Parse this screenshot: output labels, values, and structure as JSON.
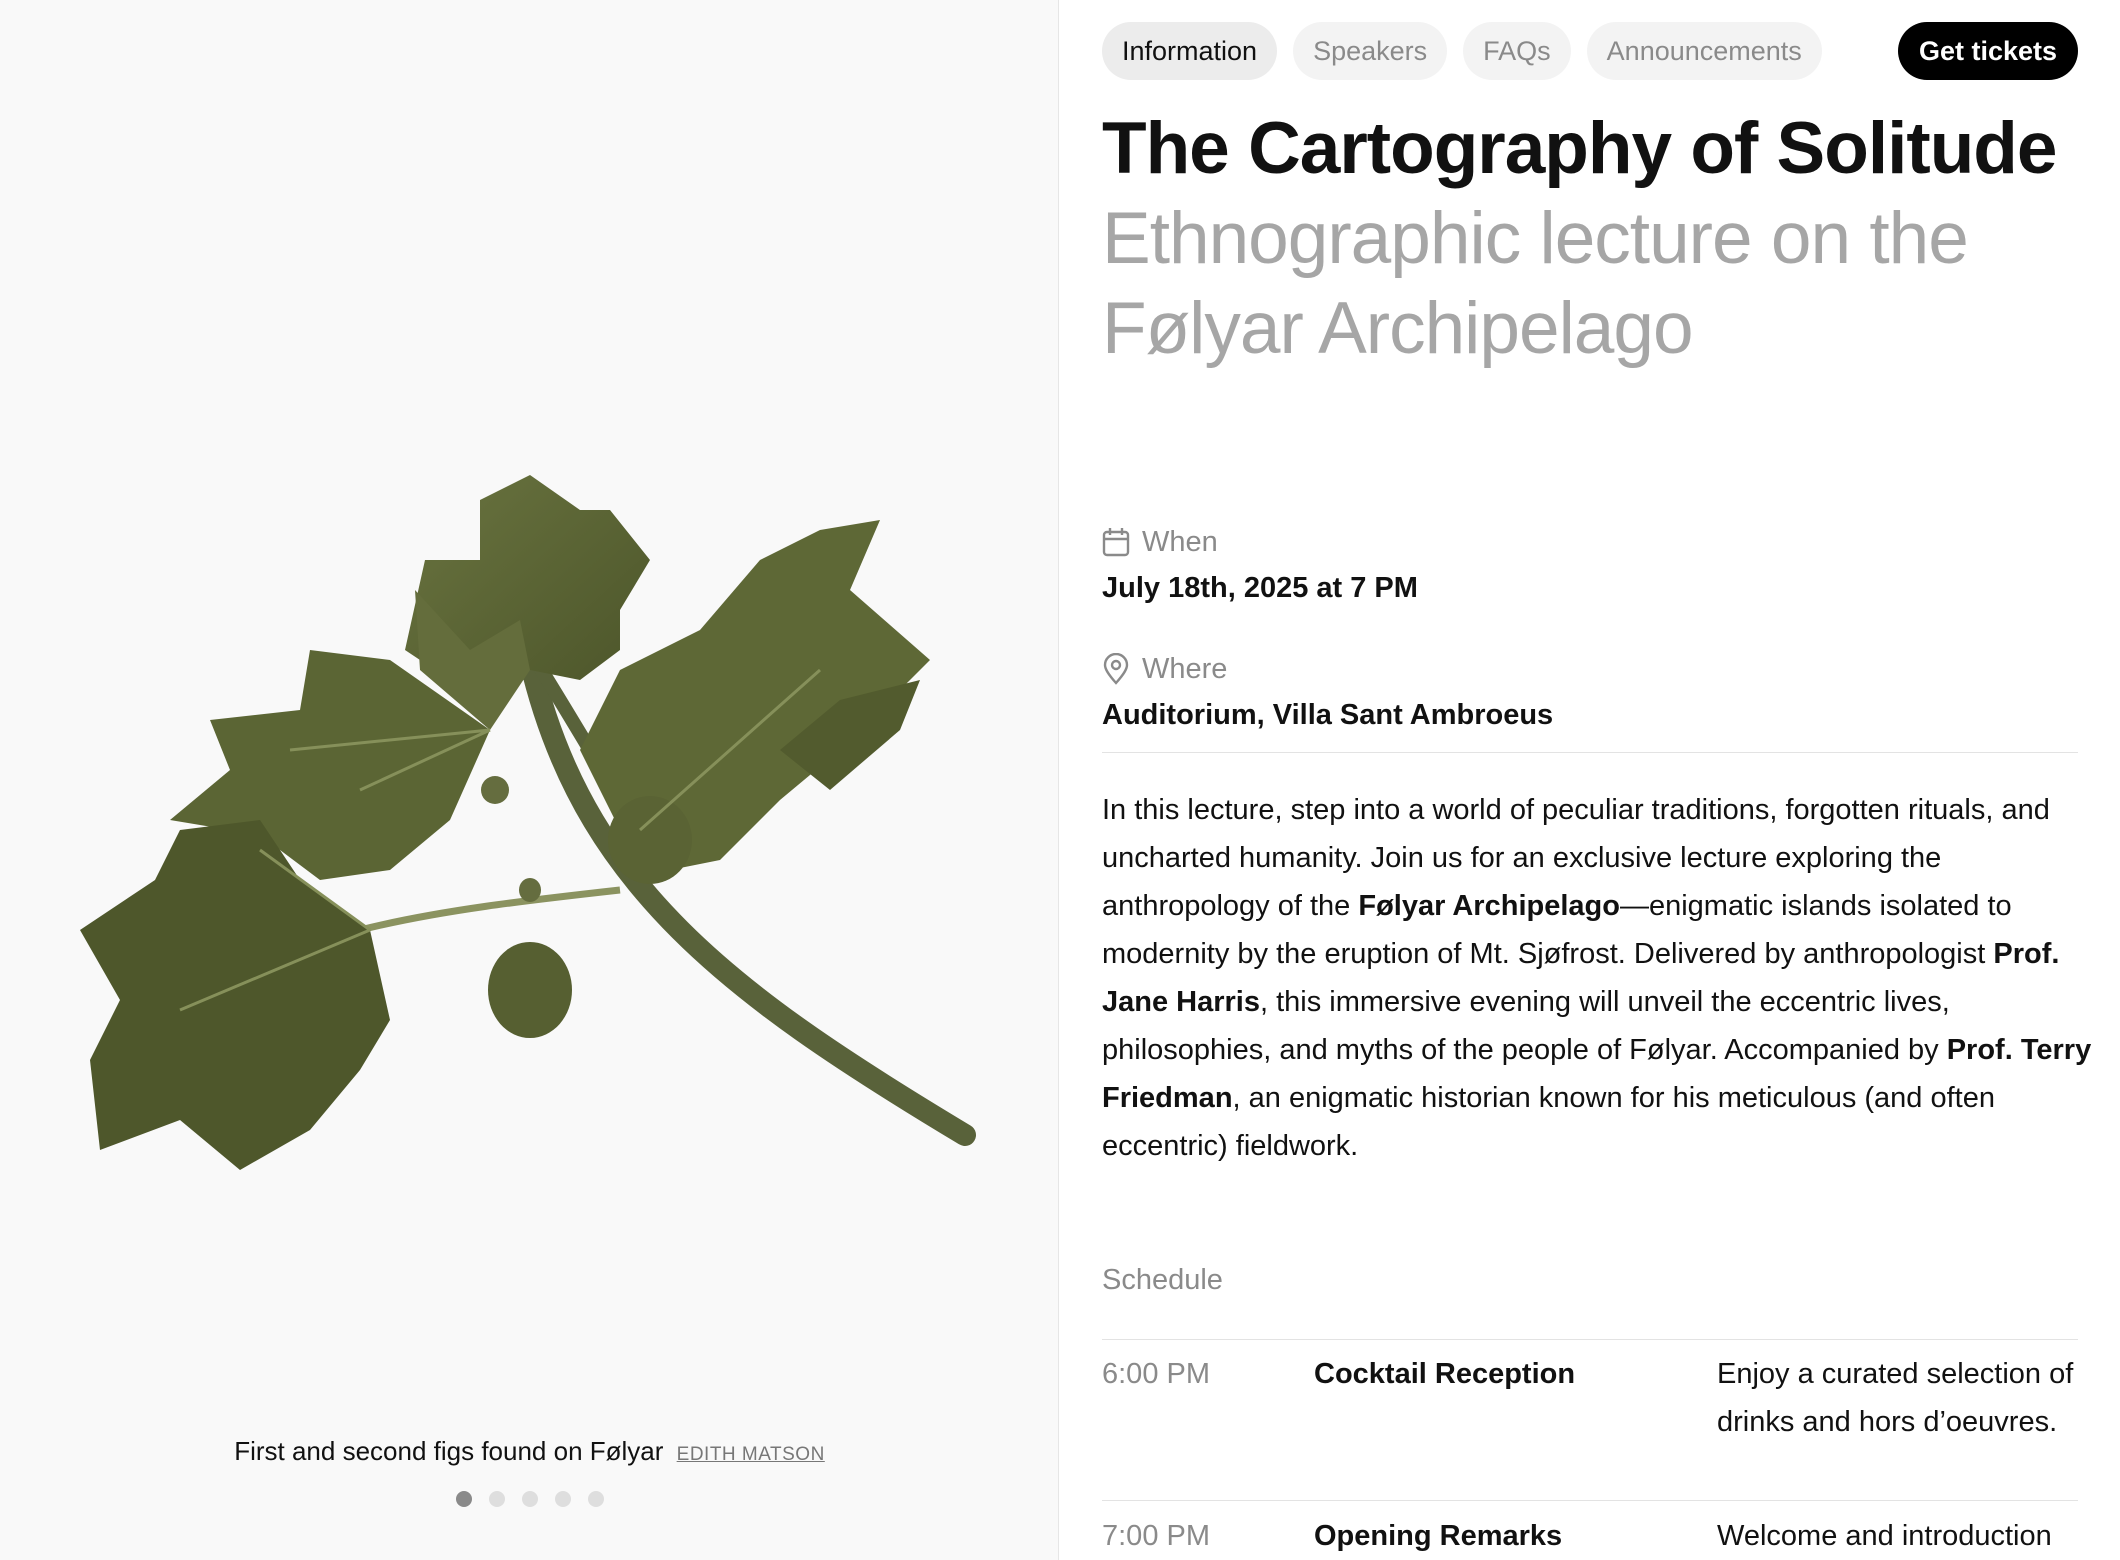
{
  "gallery": {
    "caption": "First and second figs found on Følyar",
    "credit": "EDITH MATSON",
    "image_icon": "fig-branch-illustration",
    "dot_count": 5,
    "active_dot": 1
  },
  "nav": {
    "tabs": [
      {
        "label": "Information",
        "active": true
      },
      {
        "label": "Speakers",
        "active": false
      },
      {
        "label": "FAQs",
        "active": false
      },
      {
        "label": "Announcements",
        "active": false
      }
    ],
    "cta_label": "Get tickets"
  },
  "event": {
    "title": "The Cartography of Solitude",
    "subtitle": "Ethnographic lecture on the Følyar Archipelago",
    "when_label": "When",
    "when_value": "July 18th, 2025 at 7 PM",
    "where_label": "Where",
    "where_value": "Auditorium, Villa Sant Ambroeus"
  },
  "description": {
    "p1": "In this lecture, step into a world of peculiar traditions, forgotten rituals, and uncharted humanity. Join us for an exclusive lecture exploring the anthropology of the ",
    "b1": "Følyar Archipelago",
    "p2": "—enigmatic islands isolated to modernity by the eruption of Mt. Sjøfrost. Delivered by anthropologist ",
    "b2": "Prof. Jane Harris",
    "p3": ", this immersive evening will unveil the eccentric lives, philosophies, and myths of the people of Følyar. Accompanied by ",
    "b3": "Prof. Terry Friedman",
    "p4": ", an enigmatic historian known for his meticulous (and often eccentric) fieldwork."
  },
  "schedule": {
    "title": "Schedule",
    "items": [
      {
        "time": "6:00 PM",
        "name": "Cocktail Reception",
        "desc": "Enjoy a curated selection of drinks and hors d’oeuvres."
      },
      {
        "time": "7:00 PM",
        "name": "Opening Remarks",
        "desc": "Welcome and introduction"
      }
    ]
  },
  "colors": {
    "accent": "#000000",
    "leaf": "#5a6632",
    "muted": "#8a8a8a"
  }
}
